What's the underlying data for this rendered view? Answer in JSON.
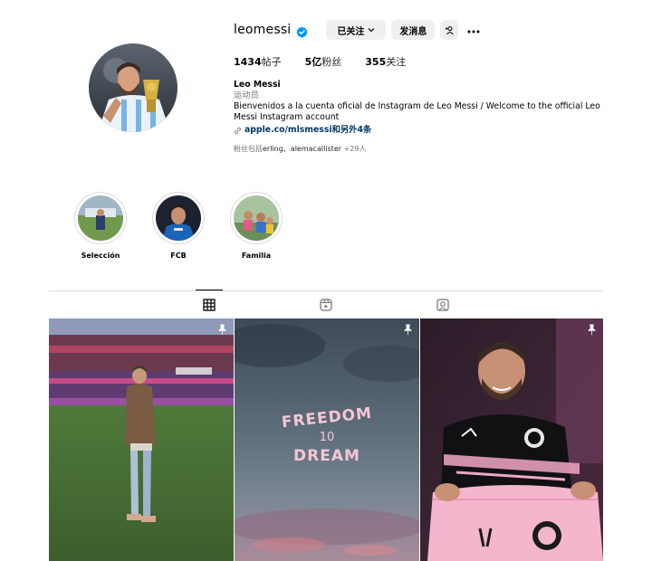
{
  "profile": {
    "username": "leomessi",
    "follow_button": "已关注",
    "message_button": "发消息",
    "stats": {
      "posts_value": "1434",
      "posts_label": "帖子",
      "followers_value": "5亿",
      "followers_label": "粉丝",
      "following_value": "355",
      "following_label": "关注"
    },
    "name": "Leo Messi",
    "category": "运动员",
    "bio": "Bienvenidos a la cuenta oficial de Instagram de Leo Messi / Welcome to the official Leo Messi Instagram account",
    "link": "apple.co/mlsmessi和另外4条",
    "followed_by_prefix": "粉丝包括",
    "followed_by_users": "erling、alemacallister",
    "followed_by_suffix": " +29人"
  },
  "highlights": [
    {
      "label": "Selección"
    },
    {
      "label": "FCB"
    },
    {
      "label": "Familia"
    }
  ],
  "tabs": [
    {
      "icon": "grid-icon",
      "active": true
    },
    {
      "icon": "reels-icon",
      "active": false
    },
    {
      "icon": "tagged-icon",
      "active": false
    }
  ],
  "posts": [
    {
      "pinned": true
    },
    {
      "pinned": true,
      "text_line1": "FREEDOM",
      "text_line2": "10",
      "text_line3": "DREAM"
    },
    {
      "pinned": true
    }
  ],
  "colors": {
    "verified": "#0095f6",
    "link": "#00376b",
    "button_bg": "#efefef"
  }
}
